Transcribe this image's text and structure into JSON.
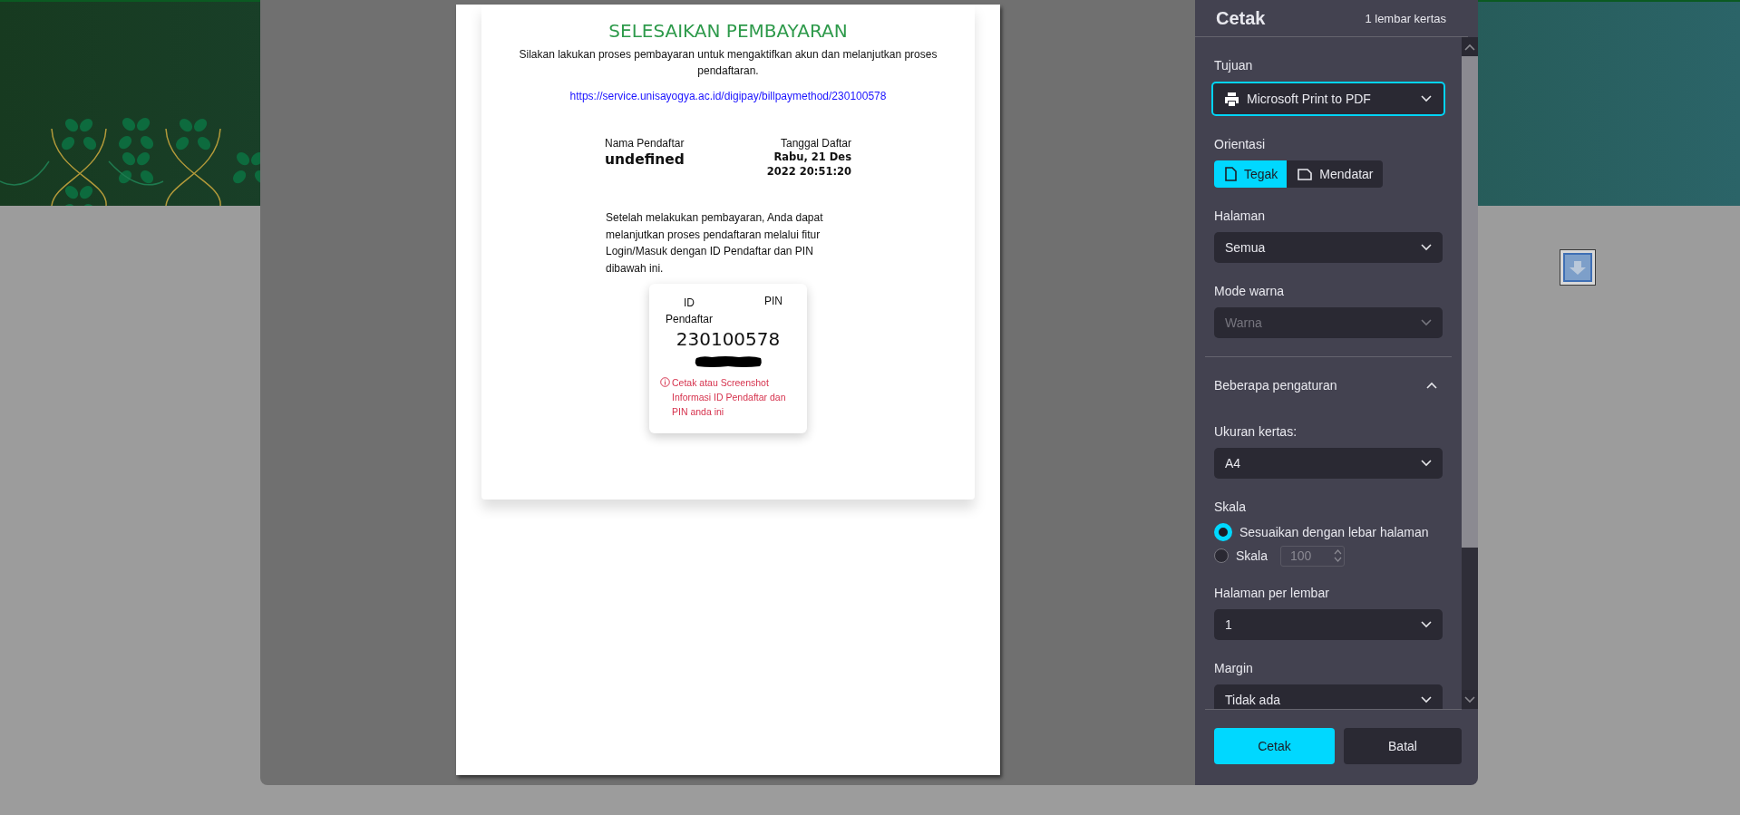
{
  "preview": {
    "title": "SELESAIKAN PEMBAYARAN",
    "intro": "Silakan lakukan proses pembayaran untuk mengaktifkan akun dan melanjutkan proses pendaftaran.",
    "link": "https://service.unisayogya.ac.id/digipay/billpaymethod/230100578",
    "registrant_label": "Nama Pendaftar",
    "registrant_name": "undefined",
    "date_label": "Tanggal Daftar",
    "date_lines": [
      "Rabu, 21 Des",
      "2022 20:51:20"
    ],
    "instructions": "Setelah melakukan pembayaran, Anda dapat melanjutkan proses pendaftaran melalui fitur Login/Masuk dengan ID Pendaftar dan PIN dibawah ini.",
    "credentials": {
      "id_label": "ID Pendaftar",
      "pin_label": "PIN",
      "id_value": "230100578",
      "warning": "Cetak atau Screenshot Informasi ID Pendaftar dan PIN anda ini"
    }
  },
  "print_dialog": {
    "title": "Cetak",
    "sheet_count": "1 lembar kertas",
    "settings": [
      {
        "kind": "destination",
        "label": "Tujuan",
        "value": "Microsoft Print to PDF",
        "focused": true,
        "disabled": false
      },
      {
        "kind": "toggle",
        "label": "Orientasi",
        "options": [
          {
            "label": "Tegak",
            "kind": "portrait",
            "selected": true
          },
          {
            "label": "Mendatar",
            "kind": "landscape",
            "selected": false
          }
        ]
      },
      {
        "kind": "select",
        "label": "Halaman",
        "value": "Semua",
        "focused": false,
        "disabled": false
      },
      {
        "kind": "select",
        "label": "Mode warna",
        "value": "Warna",
        "focused": false,
        "disabled": true
      },
      {
        "kind": "section",
        "label": "Beberapa pengaturan",
        "expanded": true
      },
      {
        "kind": "select",
        "label": "Ukuran kertas:",
        "value": "A4",
        "focused": false,
        "disabled": false
      },
      {
        "kind": "radio",
        "label": "Skala",
        "options": [
          {
            "label": "Sesuaikan dengan lebar halaman",
            "selected": true
          },
          {
            "label": "Skala",
            "selected": false,
            "field": "100"
          }
        ]
      },
      {
        "kind": "select",
        "label": "Halaman per lembar",
        "value": "1",
        "focused": false,
        "disabled": false
      },
      {
        "kind": "select",
        "label": "Margin",
        "value": "Tidak ada",
        "focused": false,
        "disabled": false
      }
    ],
    "buttons": [
      {
        "label": "Cetak",
        "kind": "primary"
      },
      {
        "label": "Batal",
        "kind": "secondary"
      }
    ]
  }
}
